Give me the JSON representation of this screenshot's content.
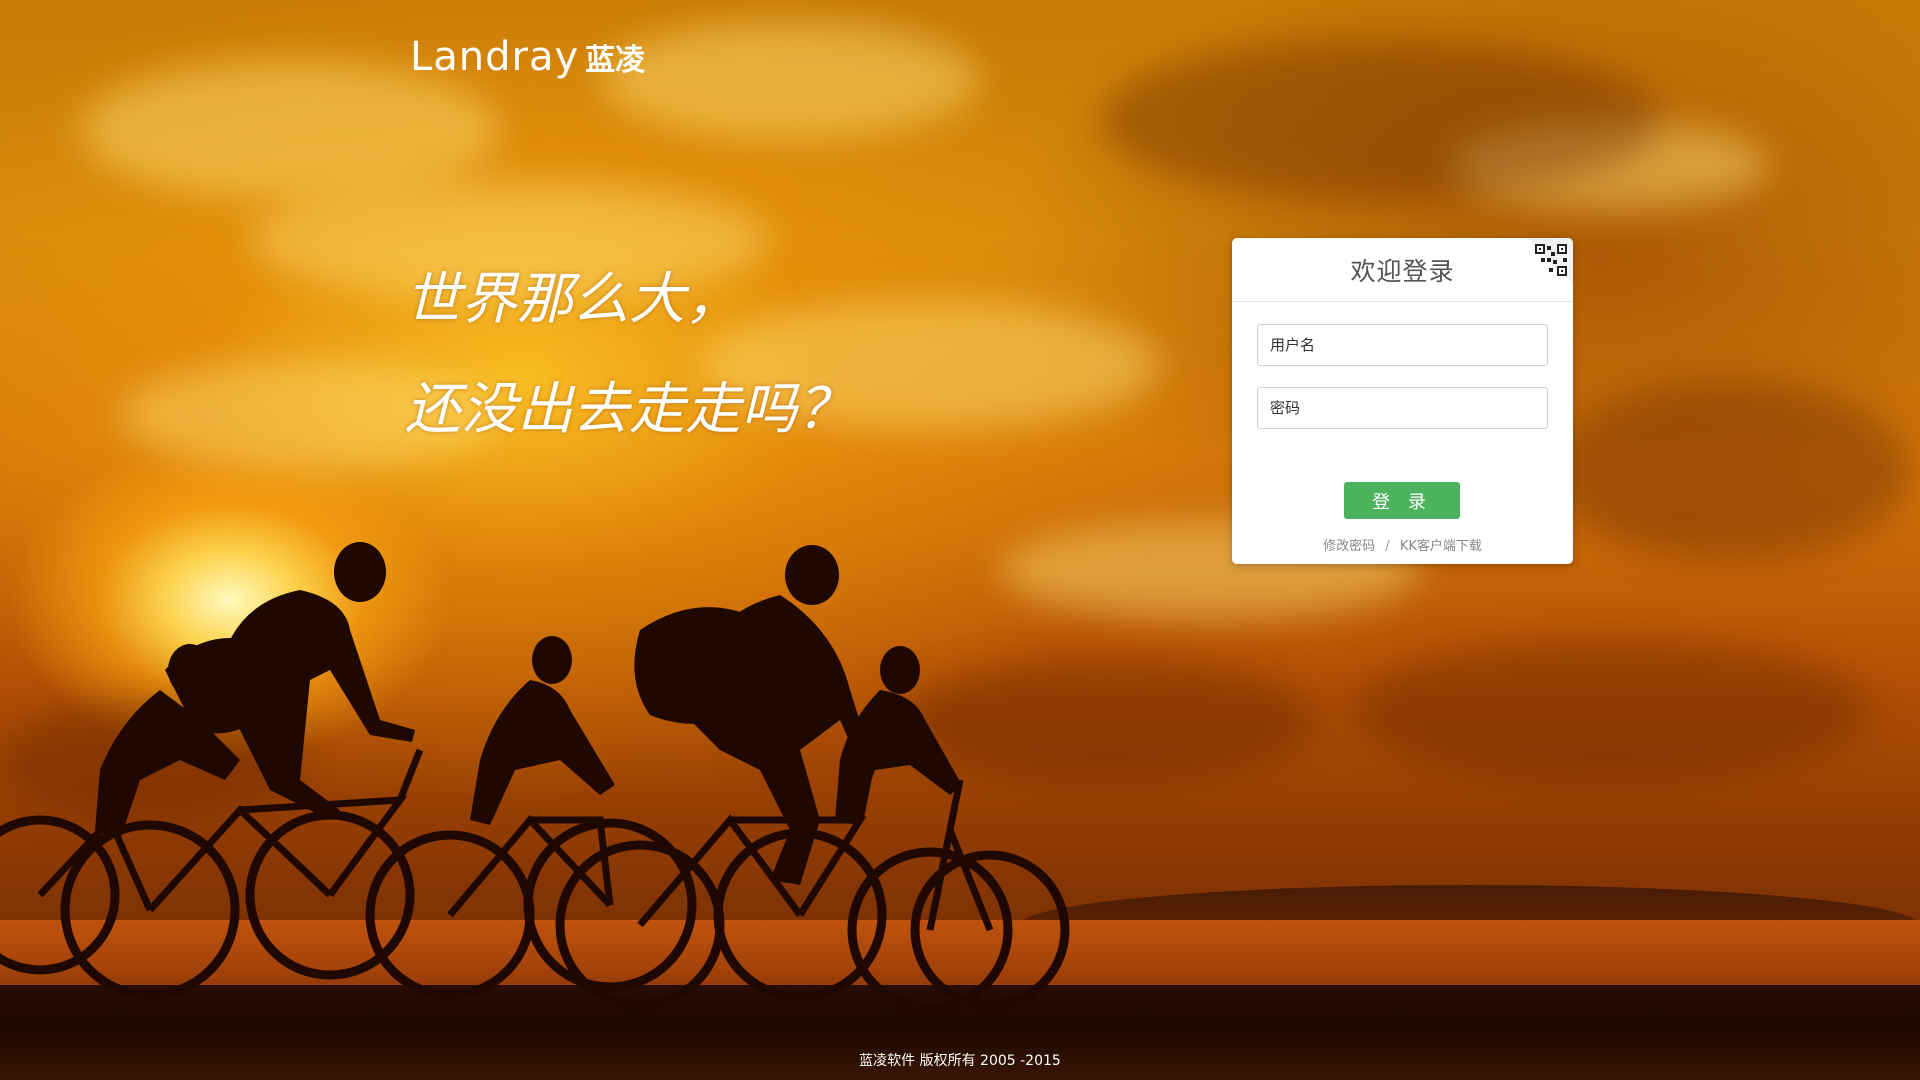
{
  "brand": {
    "logo_en": "Landray",
    "logo_cn": "蓝凌"
  },
  "slogan": {
    "line1": "世界那么大，",
    "line2": "还没出去走走吗？"
  },
  "login": {
    "title": "欢迎登录",
    "qr_icon": "qr-code-icon",
    "username_placeholder": "用户名",
    "password_placeholder": "密码",
    "submit_label": "登 录",
    "change_password_link": "修改密码",
    "separator": "/",
    "kk_download_link": "KK客户端下载"
  },
  "footer": {
    "copyright": "蓝凌软件 版权所有 2005 -2015"
  },
  "colors": {
    "login_button": "#4cb25e",
    "panel_bg": "#ffffff",
    "sky_top": "#c77a06",
    "sky_bottom": "#5a2203"
  }
}
